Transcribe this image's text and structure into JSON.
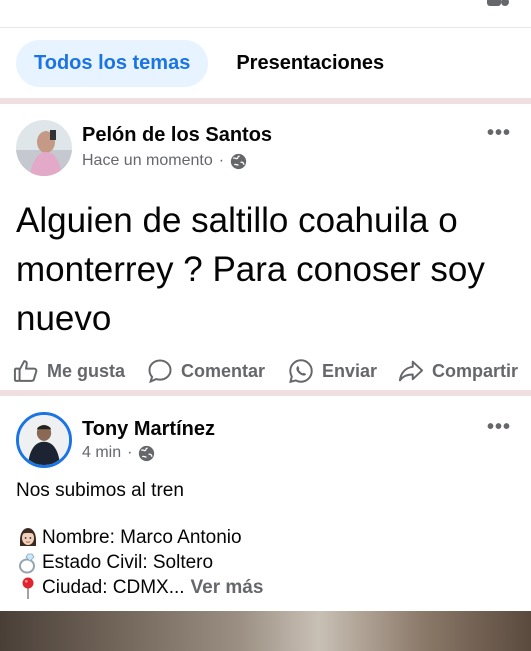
{
  "tabs": [
    {
      "label": "Todos los temas",
      "active": true
    },
    {
      "label": "Presentaciones",
      "active": false
    }
  ],
  "posts": [
    {
      "author": "Pelón de los Santos",
      "time": "Hace un momento",
      "text": "Alguien de saltillo coahuila o monterrey ? Para conoser soy nuevo",
      "actions": {
        "like": "Me gusta",
        "comment": "Comentar",
        "send": "Enviar",
        "share": "Compartir"
      }
    },
    {
      "author": "Tony Martínez",
      "time": "4 min",
      "text": "Nos subimos al tren",
      "lines": [
        {
          "icon": "woman-emoji-icon",
          "text": "Nombre: Marco Antonio"
        },
        {
          "icon": "ring-emoji-icon",
          "text": "Estado Civil: Soltero"
        },
        {
          "icon": "pin-emoji-icon",
          "text": "Ciudad: CDMX..."
        }
      ],
      "see_more": "Ver más"
    }
  ],
  "colors": {
    "accent": "#1b74e4",
    "accent_bg": "#e7f3ff",
    "secondary_text": "#65676b",
    "divider": "#f0dfe1"
  }
}
